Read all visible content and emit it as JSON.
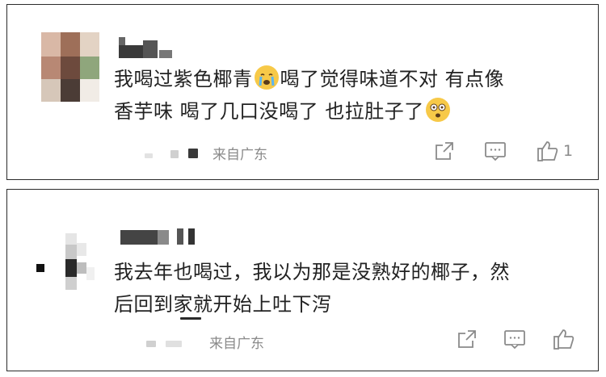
{
  "comments": [
    {
      "text_lines": [
        "我喝过紫色椰青",
        "喝了觉得味道不对 有点像",
        "香芋味 喝了几口没喝了 也拉肚子了"
      ],
      "source": "来自广东",
      "like_count": "1",
      "emojis": [
        "crying-face-emoji",
        "dizzy-face-emoji"
      ]
    },
    {
      "text_lines": [
        "我去年也喝过，我以为那是没熟好的椰子，然",
        "后回到家就开始上吐下泻"
      ],
      "source": "来自广东",
      "like_count": ""
    }
  ],
  "icons": {
    "share": "share-icon",
    "comment": "comment-icon",
    "like": "thumbs-up-icon"
  },
  "colors": {
    "text": "#222222",
    "secondary": "#8a8a8a",
    "border": "#2b2b2b"
  }
}
